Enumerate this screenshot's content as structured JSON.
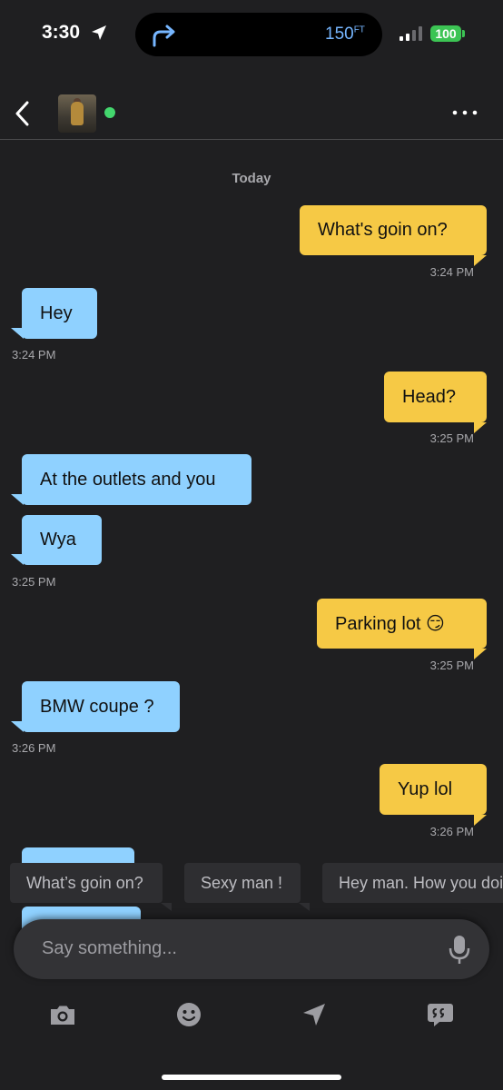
{
  "status_bar": {
    "time": "3:30",
    "distance": "150",
    "distance_unit": "FT",
    "battery": "100"
  },
  "header": {
    "online": true
  },
  "conversation": {
    "day_label": "Today",
    "messages": [
      {
        "text": "What's goin on?",
        "time": "3:24 PM",
        "from": "me"
      },
      {
        "text": "Hey",
        "time": "3:24 PM",
        "from": "them"
      },
      {
        "text": "Head?",
        "time": "3:25 PM",
        "from": "me"
      },
      {
        "text": "At the outlets and you",
        "from": "them"
      },
      {
        "text": "Wya",
        "time": "3:25 PM",
        "from": "them"
      },
      {
        "text": "Parking lot 😏",
        "time": "3:25 PM",
        "from": "me"
      },
      {
        "text": "BMW coupe ?",
        "time": "3:26 PM",
        "from": "them"
      },
      {
        "text": "Yup lol",
        "time": "3:26 PM",
        "from": "me"
      }
    ]
  },
  "quick_replies": [
    "What’s goin on?",
    "Sexy man !",
    "Hey man. How you doi"
  ],
  "composer": {
    "placeholder": "Say something..."
  },
  "toolbar": {
    "icons": [
      "camera-icon",
      "emoji-icon",
      "location-icon",
      "saved-phrases-icon"
    ]
  },
  "colors": {
    "outgoing_bubble": "#f6c945",
    "incoming_bubble": "#8fd1ff",
    "background": "#1f1f21",
    "online": "#43d66d"
  }
}
